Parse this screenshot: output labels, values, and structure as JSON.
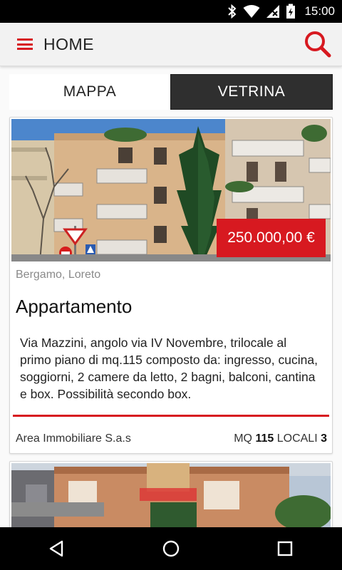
{
  "status_bar": {
    "time": "15:00",
    "icons": [
      "bluetooth-icon",
      "wifi-icon",
      "signal-icon",
      "battery-charging-icon"
    ]
  },
  "app_bar": {
    "title": "HOME",
    "menu_icon": "menu-icon",
    "search_icon": "search-icon"
  },
  "tabs": [
    {
      "label": "MAPPA",
      "active": false
    },
    {
      "label": "VETRINA",
      "active": true
    }
  ],
  "listings": [
    {
      "price": "250.000,00 €",
      "location": "Bergamo, Loreto",
      "type": "Appartamento",
      "description": "Via Mazzini, angolo via IV Novembre, trilocale al primo piano di mq.115 composto da: ingresso, cucina, soggiorni, 2 camere da letto, 2 bagni, balconi, cantina e box. Possibilità secondo box.",
      "agency": "Area Immobiliare S.a.s",
      "mq_label": "MQ",
      "mq_value": "115",
      "locali_label": "LOCALI",
      "locali_value": "3"
    }
  ],
  "nav_bar": {
    "icons": [
      "back-icon",
      "home-icon",
      "recents-icon"
    ]
  },
  "colors": {
    "accent": "#d71920",
    "tab_active_bg": "#2f2f2f",
    "app_bar_bg": "#f2f2f2"
  }
}
